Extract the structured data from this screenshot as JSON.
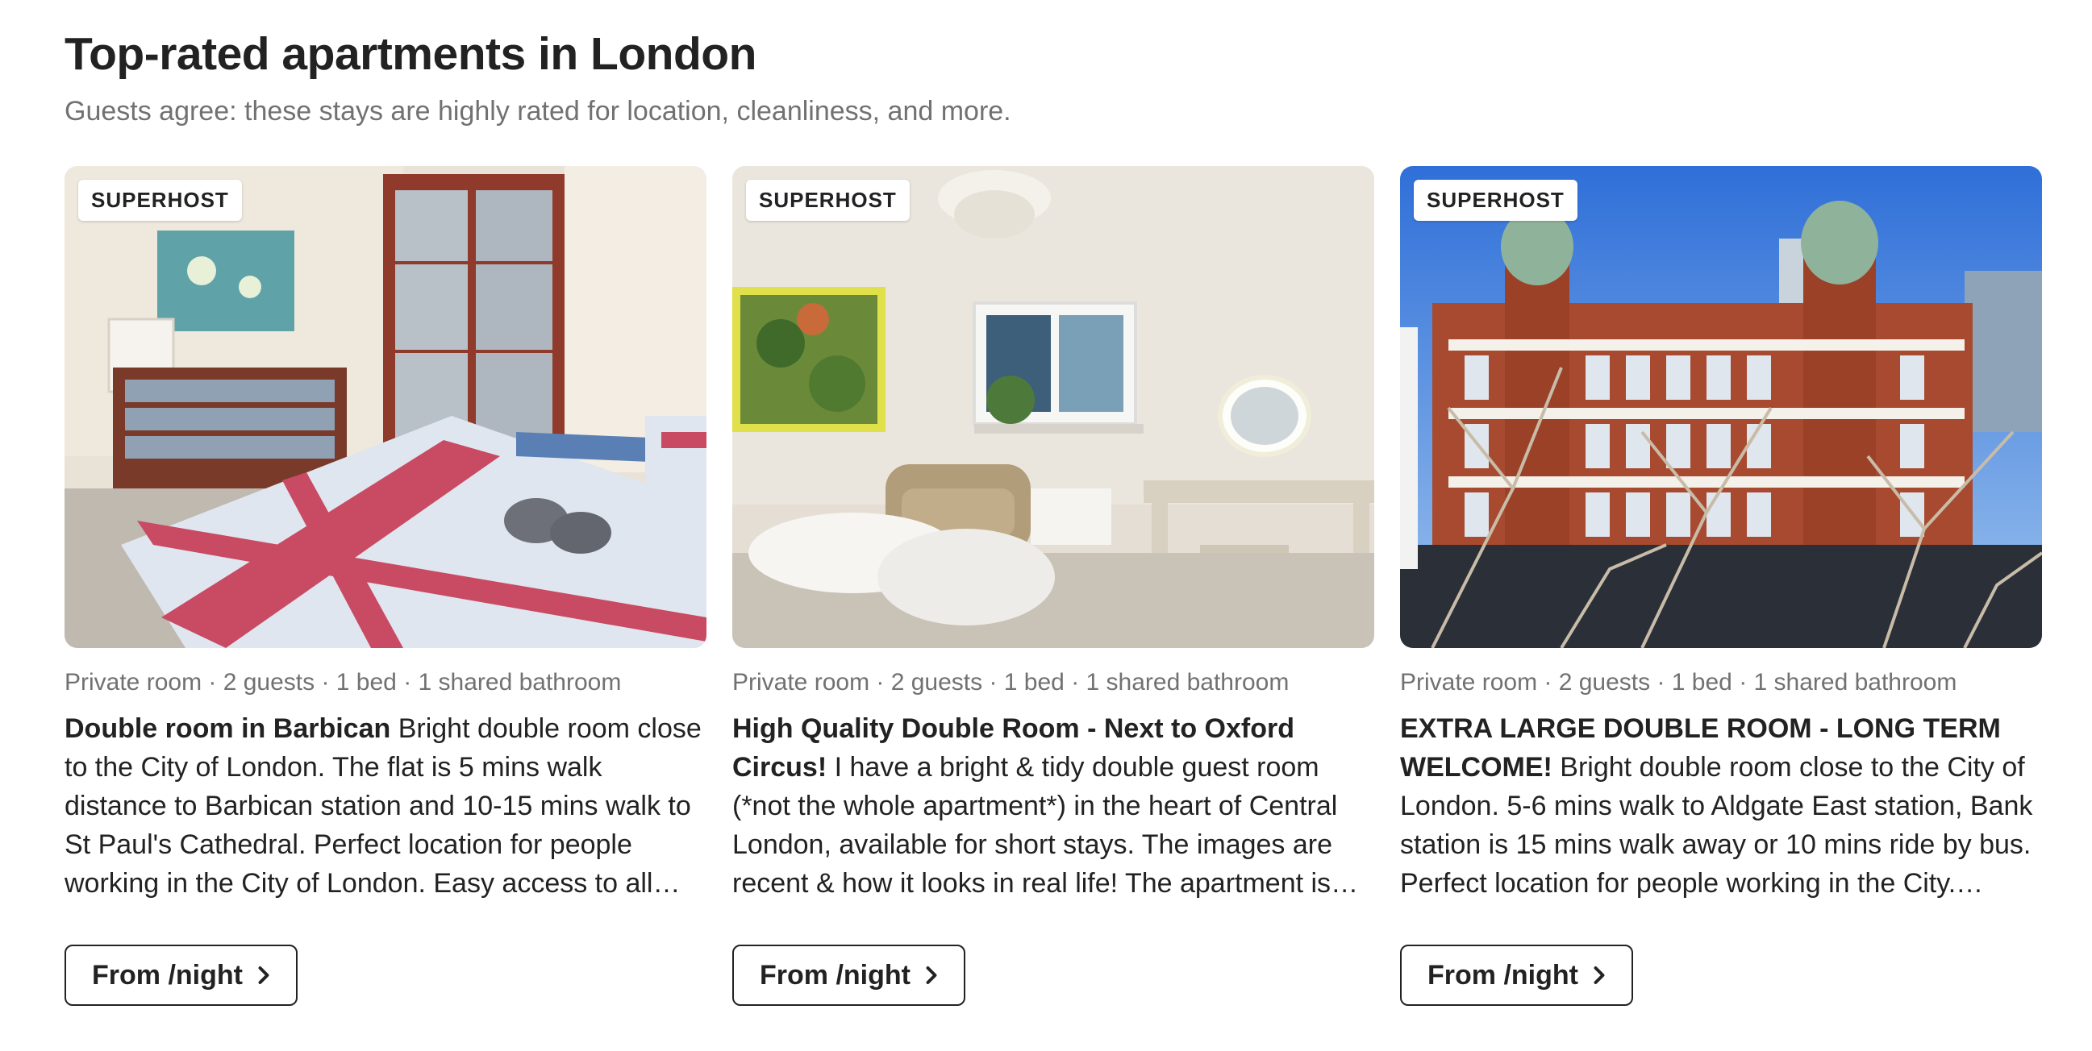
{
  "section": {
    "title": "Top-rated apartments in London",
    "subtitle": "Guests agree: these stays are highly rated for location, cleanliness, and more."
  },
  "listings": [
    {
      "badge": "SUPERHOST",
      "meta": "Private room · 2 guests · 1 bed · 1 shared bathroom",
      "name": "Double room in Barbican",
      "description": " Bright double room close to the City of London. The flat is 5 mins walk distance to Barbican station and 10-15 mins walk to St Paul's Cathedral. Perfect location for people working in the City of London. Easy access to all amenities, grocery…",
      "cta": "From /night",
      "photo_icon": "bedroom-union-jack-photo"
    },
    {
      "badge": "SUPERHOST",
      "meta": "Private room · 2 guests · 1 bed · 1 shared bathroom",
      "name": "High Quality Double Room - Next to Oxford Circus!",
      "description": " I have a bright & tidy double guest room (*not the whole apartment*) in the heart of Central London, available for short stays. The images are recent & how it looks in real life! The apartment is quiet, clean, new…",
      "cta": "From /night",
      "photo_icon": "bedroom-chandelier-photo"
    },
    {
      "badge": "SUPERHOST",
      "meta": "Private room · 2 guests · 1 bed · 1 shared bathroom",
      "name": "EXTRA LARGE DOUBLE ROOM - LONG TERM WELCOME!",
      "description": " Bright double room close to the City of London. 5-6 mins walk to Aldgate East station, Bank station is 15 mins walk away or 10 mins ride by bus. Perfect location for people working in the City. Easy…",
      "cta": "From /night",
      "photo_icon": "brick-building-view-photo"
    }
  ],
  "colors": {
    "text_primary": "#222222",
    "text_secondary": "#717171",
    "background": "#ffffff"
  }
}
